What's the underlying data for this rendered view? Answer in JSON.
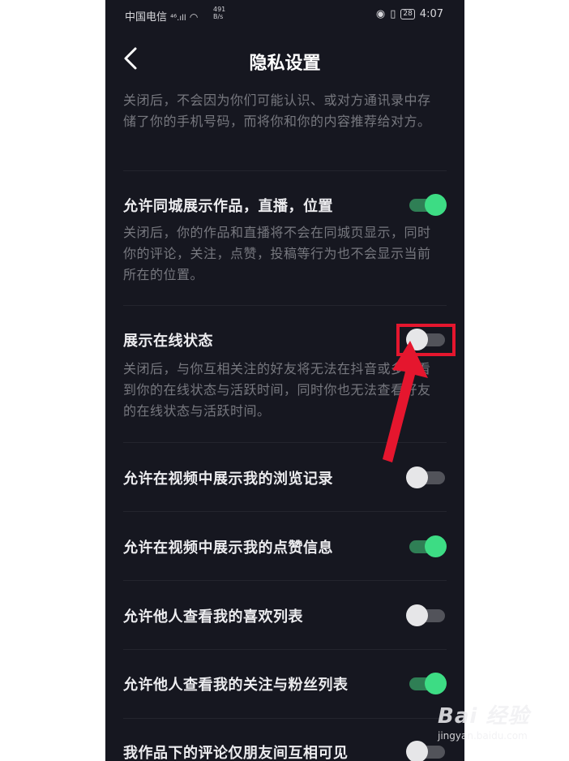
{
  "status_bar": {
    "carrier": "中国电信",
    "signal": "⁴⁶.ıll",
    "net_speed_value": "491",
    "net_speed_unit": "B/s",
    "battery": "28",
    "time": "4:07"
  },
  "header": {
    "title": "隐私设置"
  },
  "sections": {
    "top_desc": "关闭后，不会因为你们可能认识、或对方通讯录中存储了你的手机号码，而将你和你的内容推荐给对方。",
    "city": {
      "label": "允许同城展示作品，直播，位置",
      "desc": "关闭后，你的作品和直播将不会在同城页显示，同时你的评论，关注，点赞，投稿等行为也不会显示当前所在的位置。",
      "enabled": true
    },
    "online": {
      "label": "展示在线状态",
      "desc": "关闭后，与你互相关注的好友将无法在抖音或多闪看到你的在线状态与活跃时间，同时你也无法查看好友的在线状态与活跃时间。",
      "enabled": false
    },
    "browse_history": {
      "label": "允许在视频中展示我的浏览记录",
      "enabled": false
    },
    "likes": {
      "label": "允许在视频中展示我的点赞信息",
      "enabled": true
    },
    "favorites": {
      "label": "允许他人查看我的喜欢列表",
      "enabled": false
    },
    "follows": {
      "label": "允许他人查看我的关注与粉丝列表",
      "enabled": true
    },
    "comments": {
      "label": "我作品下的评论仅朋友间互相可见",
      "enabled": false
    }
  },
  "watermark": {
    "logo": "Bai 经验",
    "url": "jingyan.baidu.com"
  },
  "colors": {
    "background": "#161720",
    "toggle_on": "#3ddc84",
    "toggle_off": "#e6e6e8",
    "highlight": "#e5162e"
  }
}
